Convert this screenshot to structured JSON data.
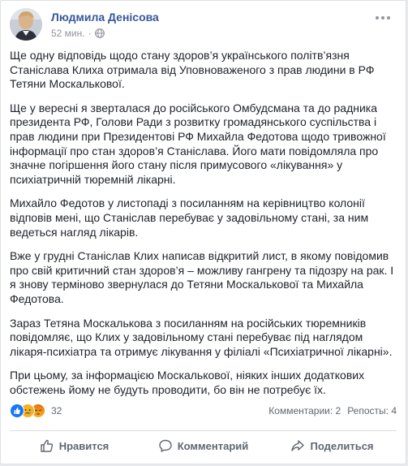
{
  "post": {
    "author": "Людмила Денісова",
    "time": "52 мин.",
    "separator": "·",
    "privacy_icon": "globe-icon",
    "paragraphs": [
      "Ще одну відповідь щодо стану здоров’я українського політв’язня Станіслава Клиха отримала від Уповноваженого з прав людини в РФ Тетяни Москалькової.",
      "Ще у вересні я зверталася до російського Омбудсмана та до радника президента РФ, Голови Ради з розвитку громадянського суспільства і прав людини при Президентові РФ Михайла Федотова щодо тривожної інформації про стан здоров’я Станіслава. Його мати повідомляла про значне погіршення його стану після примусового «лікування» у психіатричній тюремній лікарні.",
      "Михайло Федотов у листопаді з посиланням на керівництво колонії відповів мені, що Станіслав перебуває у задовільному стані, за ним ведеться нагляд лікарів.",
      "Вже у грудні Станіслав Клих написав відкритий лист, в якому повідомив про свій критичний стан здоров’я – можливу гангрену та підозру на рак. І я знову терміново звернулася до Тетяни Москалькової та Михайла Федотова.",
      "Зараз Тетяна Москалькова з посиланням на російських тюремників повідомляє, що Клих у задовільному стані перебуває під наглядом лікаря-психіатра та отримує лікування у філіалі «Психіатричної лікарні».",
      "При цьому, за інформацією Москалькової, ніяких інших додаткових обстежень йому не будуть проводити, бо він не потребує їх."
    ]
  },
  "reactions": {
    "icons": [
      "like-icon",
      "sad-icon",
      "angry-icon"
    ],
    "count": "32",
    "comments": "Комментарии: 2",
    "shares": "Репосты: 4"
  },
  "actions": {
    "like": "Нравится",
    "comment": "Комментарий",
    "share": "Поделиться"
  },
  "colors": {
    "author_link": "#365899",
    "text": "#1d2129",
    "muted": "#90949c",
    "like_blue": "#1877f2"
  }
}
